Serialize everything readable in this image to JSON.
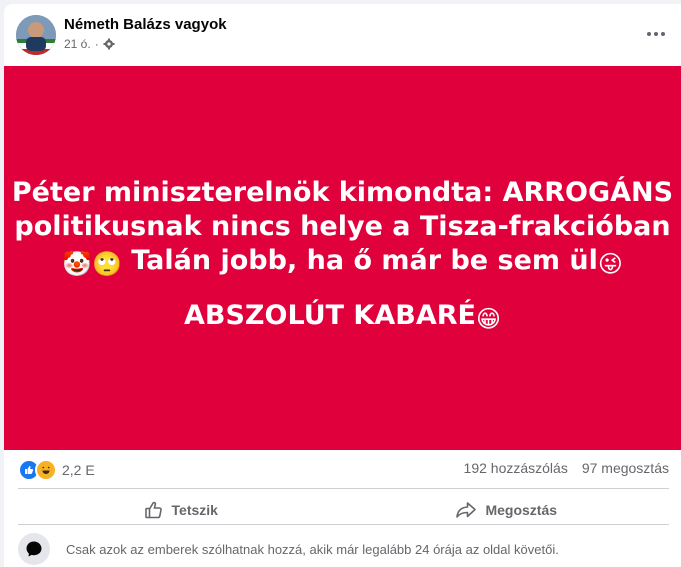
{
  "post": {
    "author": "Németh Balázs vagyok",
    "time": "21 ó.",
    "separator": "·",
    "icons": {
      "privacy": "gear-icon",
      "more": "more-options-icon"
    }
  },
  "banner": {
    "background": "#e0003c",
    "text_color": "#ffffff",
    "line1": "Péter miniszterelnök kimondta: ARROGÁNS",
    "line2": "politikusnak nincs helye a Tisza-frakcióban",
    "line3_emoji1": "🤡",
    "line3_emoji2": "🙄",
    "line3_text": " Talán jobb, ha ő már be sem ül",
    "line3_emoji3": "😜",
    "line4_text": "ABSZOLÚT KABARÉ",
    "line4_emoji": "😁"
  },
  "stats": {
    "reactions_count": "2,2 E",
    "reaction_types": [
      "like-reaction-icon",
      "haha-reaction-icon"
    ],
    "comments": "192 hozzászólás",
    "shares": "97 megosztás"
  },
  "actions": {
    "like_label": "Tetszik",
    "share_label": "Megosztás"
  },
  "comment_notice": {
    "text": "Csak azok az emberek szólhatnak hozzá, akik már legalább 24 órája az oldal követői."
  }
}
